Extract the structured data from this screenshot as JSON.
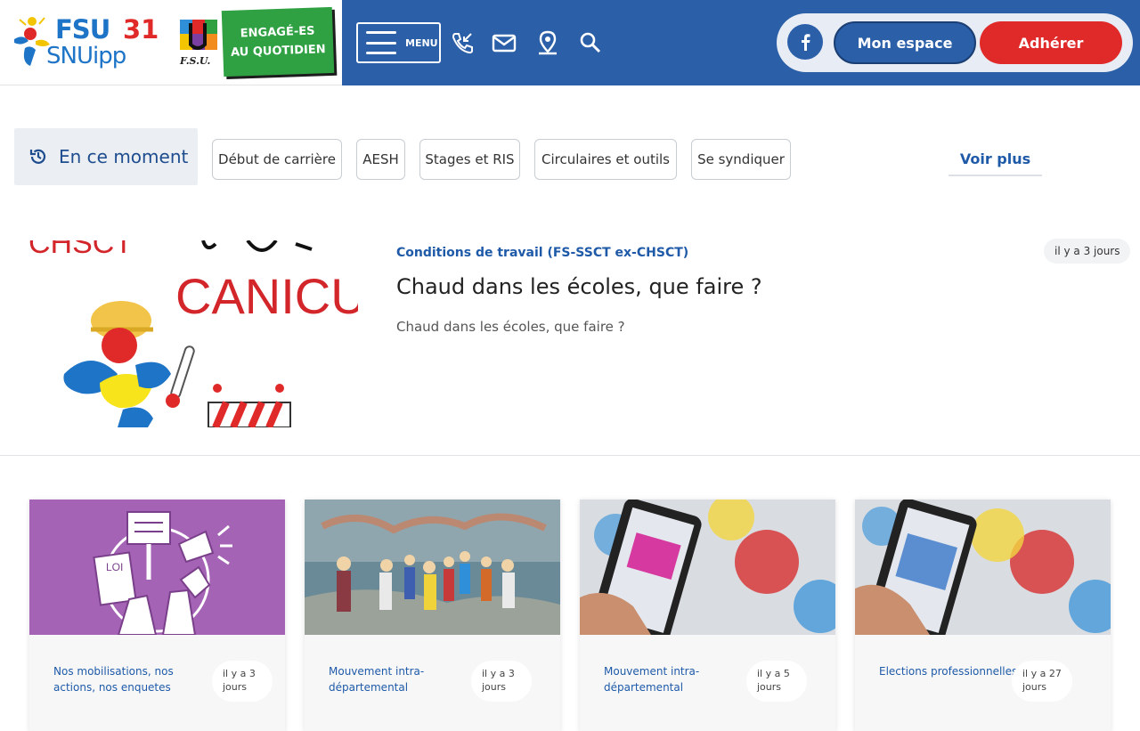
{
  "header": {
    "logo": {
      "fsu": "FSU",
      "number": "31",
      "snuipp": "SNUipp",
      "fsu_small": "F.S.U."
    },
    "slogan": {
      "line1": "ENGAGÉ-ES",
      "line2": "AU QUOTIDIEN"
    },
    "menu_label": "MENU",
    "icons": [
      "phone-icon",
      "mail-icon",
      "location-icon",
      "search-icon"
    ],
    "facebook_icon": "facebook-icon",
    "espace_label": "Mon espace",
    "adherer_label": "Adhérer"
  },
  "moment": {
    "label": "En ce moment",
    "icon": "history-icon",
    "chips": [
      "Début de carrière",
      "AESH",
      "Stages et RIS",
      "Circulaires et outils",
      "Se syndiquer"
    ],
    "voir_plus": "Voir plus"
  },
  "featured": {
    "image_text": "CANICULE",
    "image_partial_text": "CHSCT",
    "category": "Conditions de travail (FS-SSCT ex-CHSCT)",
    "title": "Chaud dans les écoles, que faire ?",
    "description": "Chaud dans les écoles, que faire ?",
    "date": "il y a 3 jours"
  },
  "cards": [
    {
      "category": "Nos mobilisations, nos actions, nos enquetes",
      "date_line1": "il y a 3",
      "date_line2": "jours",
      "image_text": "LOI"
    },
    {
      "category": "Mouvement intra-départemental",
      "date_line1": "il y a 3",
      "date_line2": "jours"
    },
    {
      "category": "Mouvement intra-départemental",
      "date_line1": "il y a 5",
      "date_line2": "jours"
    },
    {
      "category": "Elections professionnelles",
      "date_line1": "il y a 27",
      "date_line2": "jours"
    }
  ],
  "colors": {
    "brand_blue": "#2b5fa8",
    "accent_red": "#e02a2a",
    "slogan_green": "#2fa143",
    "link_blue": "#1e5aa8",
    "card1_purple": "#a463b4"
  }
}
